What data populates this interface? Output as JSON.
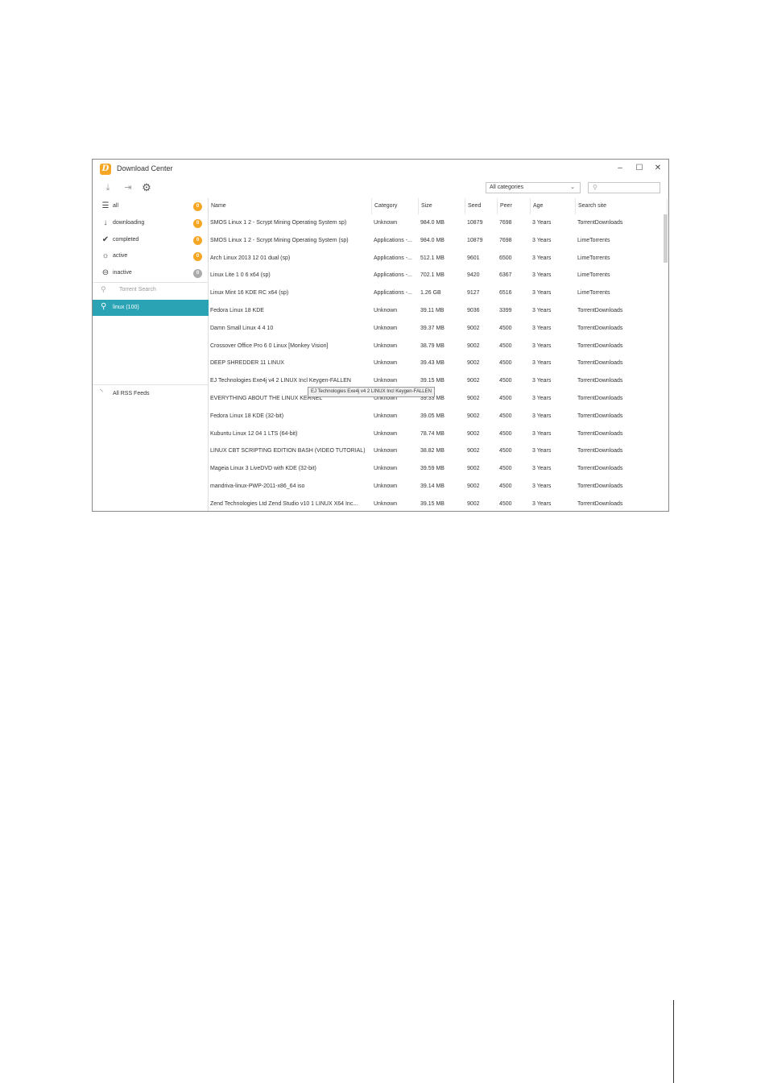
{
  "window": {
    "title": "Download Center",
    "minimize_glyph": "–",
    "maximize_glyph": "☐",
    "close_glyph": "✕"
  },
  "toolbar": {
    "category_select": "All categories"
  },
  "sidebar": {
    "items": [
      {
        "label": "all",
        "count": "0",
        "icon": "list-icon"
      },
      {
        "label": "downloading",
        "count": "0",
        "icon": "arrow-down-icon"
      },
      {
        "label": "completed",
        "count": "0",
        "icon": "check-icon"
      },
      {
        "label": "active",
        "count": "0",
        "icon": "sun-icon"
      },
      {
        "label": "inactive",
        "count": "0",
        "icon": "minus-circle-icon"
      }
    ],
    "torrent_search_placeholder": "Torrent Search",
    "active_search": "linux (100)",
    "rss_label": "All RSS Feeds"
  },
  "columns": [
    "Name",
    "Category",
    "Size",
    "Seed",
    "Peer",
    "Age",
    "Search site"
  ],
  "rows": [
    [
      "SMOS Linux 1 2 - Scrypt Mining Operating System sp)",
      "Unknown",
      "984.0 MB",
      "10879",
      "7698",
      "3 Years",
      "TorrentDownloads"
    ],
    [
      "SMOS Linux 1 2 - Scrypt Mining Operating System (sp)",
      "Applications -...",
      "984.0 MB",
      "10879",
      "7698",
      "3 Years",
      "LimeTorrents"
    ],
    [
      "Arch Linux 2013 12 01 dual (sp)",
      "Applications -...",
      "512.1 MB",
      "9601",
      "6500",
      "3 Years",
      "LimeTorrents"
    ],
    [
      "Linux Lite 1 0 6 x64 (sp)",
      "Applications -...",
      "702.1 MB",
      "9420",
      "6367",
      "3 Years",
      "LimeTorrents"
    ],
    [
      "Linux Mint 16 KDE RC x64 (sp)",
      "Applications -...",
      "1.26 GB",
      "9127",
      "6516",
      "3 Years",
      "LimeTorrents"
    ],
    [
      "Fedora Linux 18 KDE",
      "Unknown",
      "39.11 MB",
      "9036",
      "3399",
      "3 Years",
      "TorrentDownloads"
    ],
    [
      "Damn Small Linux 4 4 10",
      "Unknown",
      "39.37 MB",
      "9002",
      "4500",
      "3 Years",
      "TorrentDownloads"
    ],
    [
      "Crossover Office Pro 6 0 Linux [Monkey Vision]",
      "Unknown",
      "38.79 MB",
      "9002",
      "4500",
      "3 Years",
      "TorrentDownloads"
    ],
    [
      "DEEP SHREDDER 11 LINUX",
      "Unknown",
      "39.43 MB",
      "9002",
      "4500",
      "3 Years",
      "TorrentDownloads"
    ],
    [
      "EJ Technologies Exe4j v4 2 LINUX Incl Keygen-FALLEN",
      "Unknown",
      "39.15 MB",
      "9002",
      "4500",
      "3 Years",
      "TorrentDownloads"
    ],
    [
      "EVERYTHING ABOUT THE LINUX KERNEL",
      "Unknown",
      "39.33 MB",
      "9002",
      "4500",
      "3 Years",
      "TorrentDownloads"
    ],
    [
      "Fedora Linux 18 KDE (32-bit)",
      "Unknown",
      "39.05 MB",
      "9002",
      "4500",
      "3 Years",
      "TorrentDownloads"
    ],
    [
      "Kubuntu Linux 12 04 1 LTS (64-bit)",
      "Unknown",
      "78.74 MB",
      "9002",
      "4500",
      "3 Years",
      "TorrentDownloads"
    ],
    [
      "LINUX CBT SCRIPTING EDITION BASH (VIDEO TUTORIAL)",
      "Unknown",
      "38.82 MB",
      "9002",
      "4500",
      "3 Years",
      "TorrentDownloads"
    ],
    [
      "Mageia Linux 3 LiveDVD with KDE (32-bit)",
      "Unknown",
      "39.59 MB",
      "9002",
      "4500",
      "3 Years",
      "TorrentDownloads"
    ],
    [
      "mandriva-linux-PWP-2011-x86_64 iso",
      "Unknown",
      "39.14 MB",
      "9002",
      "4500",
      "3 Years",
      "TorrentDownloads"
    ],
    [
      "Zend Technologies Ltd Zend Studio v10 1 LINUX X64 Inc...",
      "Unknown",
      "39.15 MB",
      "9002",
      "4500",
      "3 Years",
      "TorrentDownloads"
    ]
  ],
  "tooltip": "EJ Technologies Exe4j v4 2 LINUX Incl Keygen-FALLEN",
  "colors": {
    "accent": "#2aa3b5",
    "badge": "#f5a623",
    "badge_inactive": "#aaaaaa"
  }
}
